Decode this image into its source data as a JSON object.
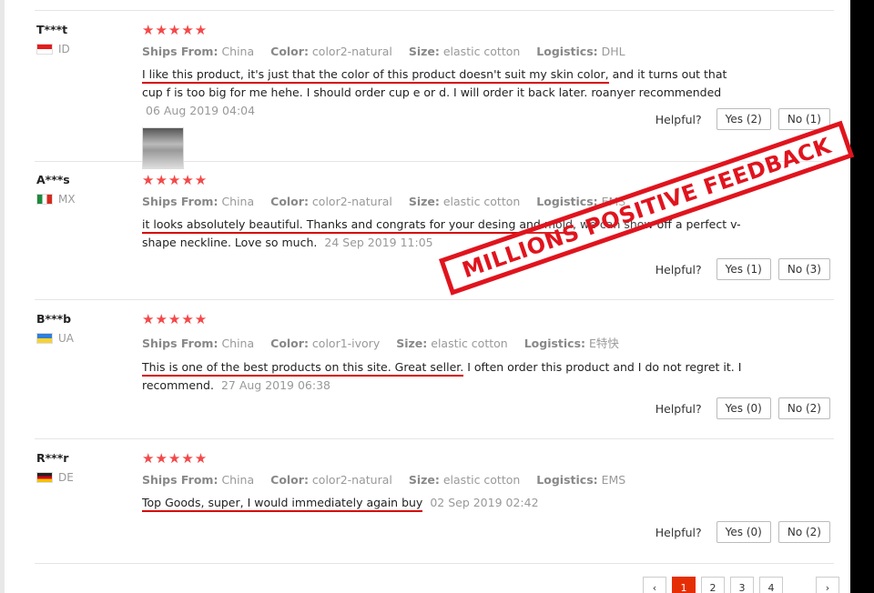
{
  "labels": {
    "ships_from": "Ships From:",
    "color": "Color:",
    "size": "Size:",
    "logistics": "Logistics:",
    "helpful": "Helpful?"
  },
  "reviews": [
    {
      "user": "T***t",
      "country": "ID",
      "stars": "★★★★★",
      "ships_from": "China",
      "color": "color2-natural",
      "size": "elastic cotton",
      "logistics": "DHL",
      "text_highlight": "I like this product, it's just that the color of this product doesn't suit my skin color,",
      "text_rest": " and it turns out that cup f is too big for me hehe. I should order cup e or d. I will order it back later. roanyer recommended",
      "date": "06 Aug 2019 04:04",
      "yes": "Yes (2)",
      "no": "No (1)"
    },
    {
      "user": "A***s",
      "country": "MX",
      "stars": "★★★★★",
      "ships_from": "China",
      "color": "color2-natural",
      "size": "elastic cotton",
      "logistics": "EMS",
      "text_highlight": "it looks absolutely beautiful. Thanks and congrats for your desing and mold,",
      "text_rest": " we can show off a perfect v-shape neckline. Love so much.",
      "date": "24 Sep 2019 11:05",
      "yes": "Yes (1)",
      "no": "No (3)"
    },
    {
      "user": "B***b",
      "country": "UA",
      "stars": "★★★★★",
      "ships_from": "China",
      "color": "color1-ivory",
      "size": "elastic cotton",
      "logistics": "E特快",
      "text_highlight": "This is one of the best products on this site. Great seller.",
      "text_rest": " I often order this product and I do not regret it. I recommend.",
      "date": "27 Aug 2019 06:38",
      "yes": "Yes (0)",
      "no": "No (2)"
    },
    {
      "user": "R***r",
      "country": "DE",
      "stars": "★★★★★",
      "ships_from": "China",
      "color": "color2-natural",
      "size": "elastic cotton",
      "logistics": "EMS",
      "text_highlight": "Top Goods, super, I would immediately again buy",
      "text_rest": "",
      "date": "02 Sep 2019 02:42",
      "yes": "Yes (0)",
      "no": "No (2)"
    }
  ],
  "pagination": {
    "prev": "‹",
    "pages": [
      "1",
      "2",
      "3",
      "4"
    ],
    "next": "›"
  },
  "stamp_text": "MILLIONS POSITIVE FEEDBACK",
  "colors": {
    "star": "#f44848",
    "underline": "#d50000",
    "stamp": "#e0141e",
    "page_active": "#e62e04"
  }
}
